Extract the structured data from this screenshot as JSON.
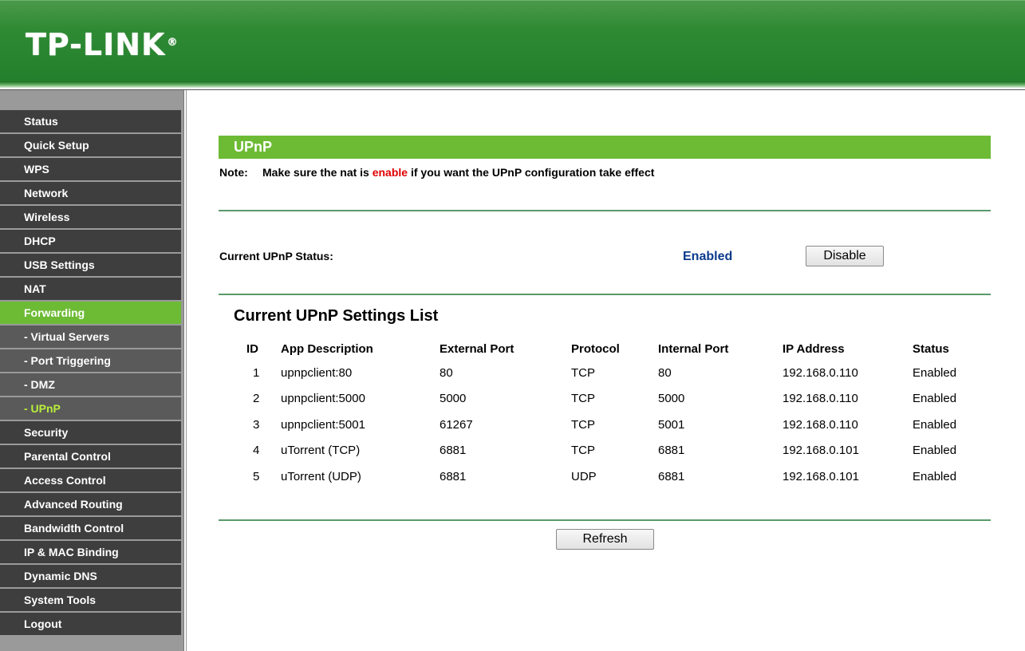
{
  "header": {
    "logo_text": "TP-LINK",
    "logo_reg": "®",
    "brand_color": "#2f8a34"
  },
  "sidebar": {
    "items": [
      {
        "label": "Status",
        "type": "main",
        "state": "normal"
      },
      {
        "label": "Quick Setup",
        "type": "main",
        "state": "normal"
      },
      {
        "label": "WPS",
        "type": "main",
        "state": "normal"
      },
      {
        "label": "Network",
        "type": "main",
        "state": "normal"
      },
      {
        "label": "Wireless",
        "type": "main",
        "state": "normal"
      },
      {
        "label": "DHCP",
        "type": "main",
        "state": "normal"
      },
      {
        "label": "USB Settings",
        "type": "main",
        "state": "normal"
      },
      {
        "label": "NAT",
        "type": "main",
        "state": "normal"
      },
      {
        "label": "Forwarding",
        "type": "main",
        "state": "active"
      },
      {
        "label": "- Virtual Servers",
        "type": "sub",
        "state": "normal"
      },
      {
        "label": "- Port Triggering",
        "type": "sub",
        "state": "normal"
      },
      {
        "label": "- DMZ",
        "type": "sub",
        "state": "normal"
      },
      {
        "label": "- UPnP",
        "type": "sub",
        "state": "active"
      },
      {
        "label": "Security",
        "type": "main",
        "state": "normal"
      },
      {
        "label": "Parental Control",
        "type": "main",
        "state": "normal"
      },
      {
        "label": "Access Control",
        "type": "main",
        "state": "normal"
      },
      {
        "label": "Advanced Routing",
        "type": "main",
        "state": "normal"
      },
      {
        "label": "Bandwidth Control",
        "type": "main",
        "state": "normal"
      },
      {
        "label": "IP & MAC Binding",
        "type": "main",
        "state": "normal"
      },
      {
        "label": "Dynamic DNS",
        "type": "main",
        "state": "normal"
      },
      {
        "label": "System Tools",
        "type": "main",
        "state": "normal"
      },
      {
        "label": "Logout",
        "type": "main",
        "state": "normal"
      }
    ],
    "active_color": "#6dbb35",
    "sub_active_text_color": "#b9ef3a"
  },
  "main": {
    "title": "UPnP",
    "note": {
      "label": "Note:",
      "text_before": "Make sure the nat is ",
      "highlight": "enable",
      "text_after": " if you want the UPnP configuration take effect"
    },
    "status": {
      "label": "Current UPnP Status:",
      "value": "Enabled",
      "button_label": "Disable"
    },
    "list": {
      "title": "Current UPnP Settings List",
      "columns": [
        "ID",
        "App Description",
        "External Port",
        "Protocol",
        "Internal Port",
        "IP Address",
        "Status"
      ],
      "rows": [
        [
          "1",
          "upnpclient:80",
          "80",
          "TCP",
          "80",
          "192.168.0.110",
          "Enabled"
        ],
        [
          "2",
          "upnpclient:5000",
          "5000",
          "TCP",
          "5000",
          "192.168.0.110",
          "Enabled"
        ],
        [
          "3",
          "upnpclient:5001",
          "61267",
          "TCP",
          "5001",
          "192.168.0.110",
          "Enabled"
        ],
        [
          "4",
          "uTorrent (TCP)",
          "6881",
          "TCP",
          "6881",
          "192.168.0.101",
          "Enabled"
        ],
        [
          "5",
          "uTorrent (UDP)",
          "6881",
          "UDP",
          "6881",
          "192.168.0.101",
          "Enabled"
        ]
      ]
    },
    "refresh_label": "Refresh"
  }
}
